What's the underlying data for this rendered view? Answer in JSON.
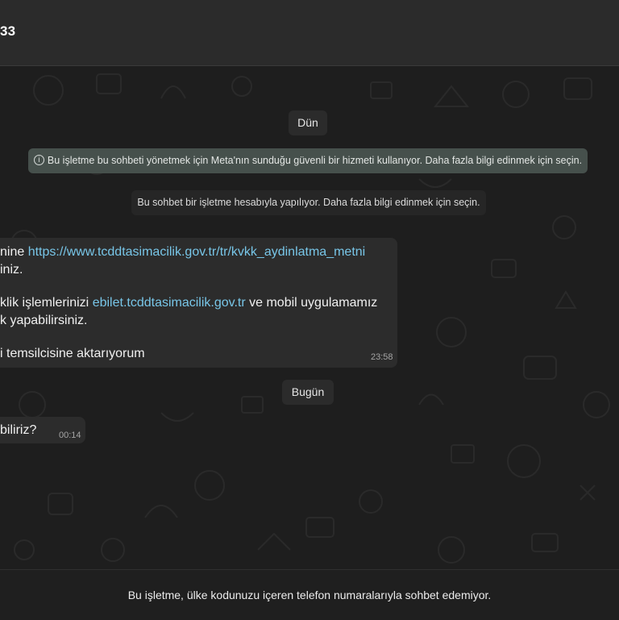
{
  "header": {
    "title": "33"
  },
  "chat": {
    "date_yesterday": "Dün",
    "meta_banner": {
      "icon": "info-icon",
      "text": "Bu işletme bu sohbeti yönetmek için Meta'nın sunduğu güvenli bir hizmeti kullanıyor. Daha fazla bilgi edinmek için seçin."
    },
    "business_note": "Bu sohbet bir işletme hesabıyla yapılıyor. Daha fazla bilgi edinmek için seçin.",
    "message1": {
      "line1_prefix": "nine ",
      "line1_link": "https://www.tcddtasimacilik.gov.tr/tr/kvkk_aydinlatma_metni",
      "line2": "iniz.",
      "line3_prefix": "klik işlemlerinizi ",
      "line3_link": "ebilet.tcddtasimacilik.gov.tr",
      "line3_suffix": " ve mobil uygulamamız",
      "line4": "k yapabilirsiniz.",
      "line5": "i temsilcisine aktarıyorum",
      "time": "23:58"
    },
    "date_today": "Bugün",
    "message2": {
      "text": "biliriz?",
      "time": "00:14"
    }
  },
  "footer": {
    "text": "Bu işletme, ülke kodunuzu içeren telefon numaralarıyla sohbet edemiyor."
  },
  "colors": {
    "link": "#78c6e8",
    "bubble": "#2c2c2c",
    "banner": "#46504c"
  }
}
